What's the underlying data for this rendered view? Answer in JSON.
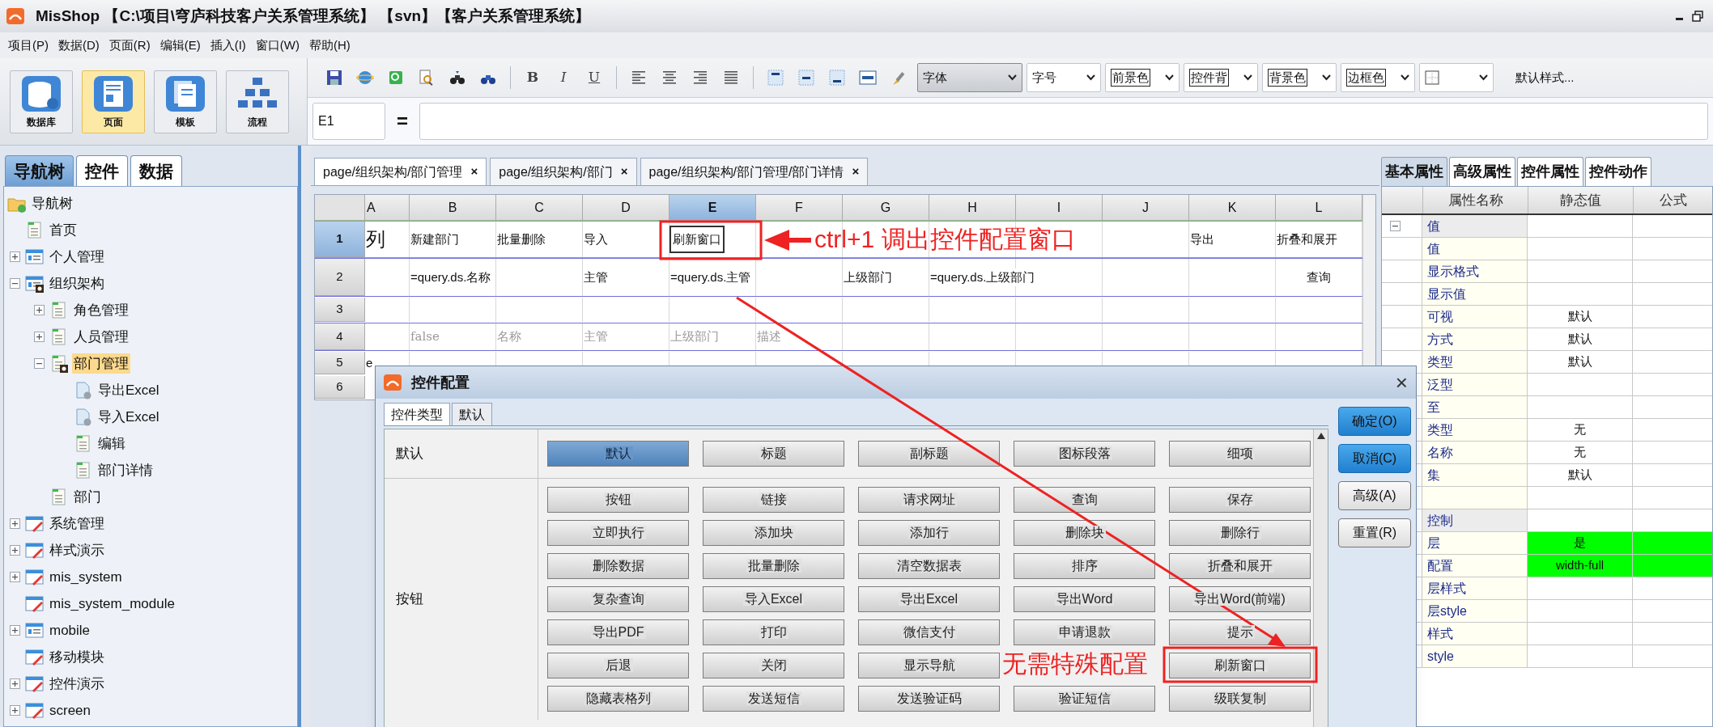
{
  "window": {
    "title": "MisShop 【C:\\项目\\穹庐科技客户关系管理系统】 【svn】【客户关系管理系统】"
  },
  "menu": [
    "项目(P)",
    "数据(D)",
    "页面(R)",
    "编辑(E)",
    "插入(I)",
    "窗口(W)",
    "帮助(H)"
  ],
  "modes": [
    {
      "label": "数据库",
      "kind": "database",
      "selected": false
    },
    {
      "label": "页面",
      "kind": "page",
      "selected": true
    },
    {
      "label": "模板",
      "kind": "template",
      "selected": false
    },
    {
      "label": "流程",
      "kind": "flow",
      "selected": false
    }
  ],
  "text_style_buttons": [
    "B",
    "I",
    "U"
  ],
  "format_selects": [
    {
      "label": "字体",
      "kind": "plain"
    },
    {
      "label": "字号",
      "kind": "plain"
    },
    {
      "label": "前景色",
      "kind": "boxed"
    },
    {
      "label": "控件背",
      "kind": "boxed"
    },
    {
      "label": "背景色",
      "kind": "boxed"
    },
    {
      "label": "边框色",
      "kind": "boxed"
    }
  ],
  "default_style": "默认样式...",
  "formula_bar": {
    "cell": "E1",
    "equals": "="
  },
  "nav_tabs": [
    {
      "label": "导航树",
      "selected": true
    },
    {
      "label": "控件",
      "selected": false
    },
    {
      "label": "数据",
      "selected": false
    }
  ],
  "tree": {
    "label": "导航树",
    "kind": "folder",
    "selected": false,
    "children": [
      {
        "label": "首页",
        "kind": "page",
        "selected": false
      },
      {
        "label": "个人管理",
        "kind": "list",
        "selected": false,
        "expanded": false
      },
      {
        "label": "组织架构",
        "kind": "list_badge",
        "selected": false,
        "expanded": true,
        "children": [
          {
            "label": "角色管理",
            "kind": "page",
            "selected": false,
            "expanded": false
          },
          {
            "label": "人员管理",
            "kind": "page",
            "selected": false,
            "expanded": false
          },
          {
            "label": "部门管理",
            "kind": "page_badge",
            "selected": true,
            "expanded": true,
            "children": [
              {
                "label": "导出Excel",
                "kind": "doc",
                "selected": false
              },
              {
                "label": "导入Excel",
                "kind": "doc",
                "selected": false
              },
              {
                "label": "编辑",
                "kind": "page",
                "selected": false
              },
              {
                "label": "部门详情",
                "kind": "page",
                "selected": false
              }
            ]
          },
          {
            "label": "部门",
            "kind": "page",
            "selected": false
          }
        ]
      },
      {
        "label": "系统管理",
        "kind": "module",
        "selected": false,
        "expanded": false
      },
      {
        "label": "样式演示",
        "kind": "module",
        "selected": false,
        "expanded": false
      },
      {
        "label": "mis_system",
        "kind": "module",
        "selected": false,
        "expanded": false
      },
      {
        "label": "mis_system_module",
        "kind": "module",
        "selected": false
      },
      {
        "label": "mobile",
        "kind": "list",
        "selected": false,
        "expanded": false
      },
      {
        "label": "移动模块",
        "kind": "module",
        "selected": false
      },
      {
        "label": "控件演示",
        "kind": "module",
        "selected": false,
        "expanded": false
      },
      {
        "label": "screen",
        "kind": "module",
        "selected": false,
        "expanded": false
      }
    ]
  },
  "doc_tabs": [
    {
      "label": "page/组织架构/部门管理",
      "close": "×",
      "selected": true
    },
    {
      "label": "page/组织架构/部门",
      "close": "×",
      "selected": false
    },
    {
      "label": "page/组织架构/部门管理/部门详情",
      "close": "×",
      "selected": false
    }
  ],
  "sheet": {
    "columns": [
      {
        "label": "A",
        "selected": false
      },
      {
        "label": "B",
        "selected": false
      },
      {
        "label": "C",
        "selected": false
      },
      {
        "label": "D",
        "selected": false
      },
      {
        "label": "E",
        "selected": true
      },
      {
        "label": "F",
        "selected": false
      },
      {
        "label": "G",
        "selected": false
      },
      {
        "label": "H",
        "selected": false
      },
      {
        "label": "I",
        "selected": false
      },
      {
        "label": "J",
        "selected": false
      },
      {
        "label": "K",
        "selected": false
      },
      {
        "label": "L",
        "selected": false
      }
    ],
    "rows": [
      {
        "header": "1",
        "kind": "component",
        "selected": true,
        "cells": [
          "列",
          "新建部门",
          "批量删除",
          "导入",
          "刷新窗口",
          null,
          null,
          null,
          null,
          null,
          "导出",
          "折叠和展开"
        ]
      },
      {
        "header": "2",
        "kind": "binding",
        "selected": false,
        "cells": [
          null,
          "=query.ds.名称",
          null,
          "主管",
          "=query.ds.主管",
          null,
          "上级部门",
          "=query.ds.上级部门",
          null,
          null,
          null,
          "查询"
        ]
      },
      {
        "header": "3",
        "kind": "plain",
        "selected": false,
        "cells": [
          null,
          null,
          null,
          null,
          null,
          null,
          null,
          null,
          null,
          null,
          null,
          null
        ]
      },
      {
        "header": "4",
        "kind": "hint",
        "selected": false,
        "cells": [
          null,
          "false",
          "名称",
          "主管",
          "上级部门",
          "描述",
          null,
          null,
          null,
          null,
          null,
          null
        ]
      },
      {
        "header": "5",
        "kind": "plain",
        "selected": false,
        "cells": [
          "e",
          null,
          null,
          null,
          null,
          null,
          null,
          null,
          null,
          null,
          null,
          null
        ]
      },
      {
        "header": "6",
        "kind": "plain",
        "selected": false,
        "cells": [
          null,
          null,
          null,
          null,
          null,
          null,
          null,
          null,
          null,
          null,
          null,
          null
        ]
      }
    ]
  },
  "properties": {
    "tabs": [
      {
        "label": "基本属性",
        "selected": true
      },
      {
        "label": "高级属性",
        "selected": false
      },
      {
        "label": "控件属性",
        "selected": false
      },
      {
        "label": "控件动作",
        "selected": false
      }
    ],
    "columns": [
      "属性名称",
      "静态值",
      "公式"
    ],
    "rows": [
      {
        "name": "值",
        "kind": "group",
        "expanded": true,
        "highlighted": false
      },
      {
        "name": "值",
        "kind": "item",
        "highlighted": false
      },
      {
        "name": "显示格式",
        "kind": "item",
        "highlighted": false
      },
      {
        "name": "显示值",
        "kind": "item",
        "highlighted": false
      },
      {
        "name": "可视",
        "kind": "item",
        "value": "默认",
        "highlighted": false
      },
      {
        "name": "方式",
        "kind": "item",
        "value": "默认",
        "highlighted": false
      },
      {
        "name": "类型",
        "kind": "item",
        "value": "默认",
        "highlighted": false
      },
      {
        "name": "泛型",
        "kind": "item",
        "highlighted": false
      },
      {
        "name": "至",
        "kind": "item",
        "highlighted": false
      },
      {
        "name": "类型",
        "kind": "item",
        "value": "无",
        "highlighted": false
      },
      {
        "name": "名称",
        "kind": "item",
        "value": "无",
        "highlighted": false
      },
      {
        "name": "集",
        "kind": "item",
        "value": "默认",
        "highlighted": false
      },
      {
        "kind": "item",
        "highlighted": false
      },
      {
        "name": "控制",
        "kind": "group",
        "highlighted": false
      },
      {
        "name": "层",
        "kind": "item",
        "value": "是",
        "highlighted": true
      },
      {
        "name": "配置",
        "kind": "item",
        "value": "width-full",
        "highlighted": true
      },
      {
        "name": "层样式",
        "kind": "item",
        "highlighted": false
      },
      {
        "name": "层style",
        "kind": "item",
        "highlighted": false
      },
      {
        "name": "样式",
        "kind": "item",
        "highlighted": false
      },
      {
        "name": "style",
        "kind": "item",
        "highlighted": false
      }
    ]
  },
  "dialog": {
    "title": "控件配置",
    "close": "×",
    "tabs": [
      {
        "label": "控件类型",
        "selected": true
      },
      {
        "label": "默认",
        "selected": false
      }
    ],
    "groups": [
      {
        "label": "默认",
        "buttons": [
          {
            "label": "默认",
            "selected": true
          },
          {
            "label": "标题",
            "selected": false
          },
          {
            "label": "副标题",
            "selected": false
          },
          {
            "label": "图标段落",
            "selected": false
          },
          {
            "label": "细项",
            "selected": false
          }
        ]
      },
      {
        "label": "按钮",
        "buttons": [
          {
            "kind": "button",
            "label": "按钮",
            "selected": false
          },
          {
            "kind": "button",
            "label": "链接",
            "selected": false
          },
          {
            "kind": "button",
            "label": "请求网址",
            "selected": false
          },
          {
            "kind": "button",
            "label": "查询",
            "selected": false
          },
          {
            "kind": "button",
            "label": "保存",
            "selected": false
          },
          {
            "kind": "button",
            "label": "立即执行",
            "selected": false
          },
          {
            "kind": "button",
            "label": "添加块",
            "selected": false
          },
          {
            "kind": "button",
            "label": "添加行",
            "selected": false
          },
          {
            "kind": "button",
            "label": "删除块",
            "selected": false
          },
          {
            "kind": "button",
            "label": "删除行",
            "selected": false
          },
          {
            "kind": "button",
            "label": "删除数据",
            "selected": false
          },
          {
            "kind": "button",
            "label": "批量删除",
            "selected": false
          },
          {
            "kind": "button",
            "label": "清空数据表",
            "selected": false
          },
          {
            "kind": "button",
            "label": "排序",
            "selected": false
          },
          {
            "kind": "button",
            "label": "折叠和展开",
            "selected": false
          },
          {
            "kind": "button",
            "label": "复杂查询",
            "selected": false
          },
          {
            "kind": "button",
            "label": "导入Excel",
            "selected": false
          },
          {
            "kind": "button",
            "label": "导出Excel",
            "selected": false
          },
          {
            "kind": "button",
            "label": "导出Word",
            "selected": false
          },
          {
            "kind": "button",
            "label": "导出Word(前端)",
            "selected": false
          },
          {
            "kind": "button",
            "label": "导出PDF",
            "selected": false
          },
          {
            "kind": "button",
            "label": "打印",
            "selected": false
          },
          {
            "kind": "button",
            "label": "微信支付",
            "selected": false
          },
          {
            "kind": "button",
            "label": "申请退款",
            "selected": false
          },
          {
            "kind": "button",
            "label": "提示",
            "selected": false
          },
          {
            "kind": "button",
            "label": "后退",
            "selected": false
          },
          {
            "kind": "button",
            "label": "关闭",
            "selected": false
          },
          {
            "kind": "button",
            "label": "显示导航",
            "selected": false
          },
          {
            "kind": "covered"
          },
          {
            "kind": "button",
            "label": "刷新窗口",
            "selected": false
          },
          {
            "kind": "button",
            "label": "隐藏表格列",
            "selected": false
          },
          {
            "kind": "button",
            "label": "发送短信",
            "selected": false
          },
          {
            "kind": "button",
            "label": "发送验证码",
            "selected": false
          },
          {
            "kind": "button",
            "label": "验证短信",
            "selected": false
          },
          {
            "kind": "button",
            "label": "级联复制",
            "selected": false
          }
        ]
      }
    ],
    "actions": [
      {
        "label": "确定(O)",
        "kind": "primary"
      },
      {
        "label": "取消(C)",
        "kind": "primary"
      },
      {
        "label": "高级(A)",
        "kind": "normal"
      },
      {
        "label": "重置(R)",
        "kind": "normal"
      }
    ]
  },
  "annotations": [
    {
      "kind": "callout",
      "text": "ctrl+1 调出控件配置窗口"
    },
    {
      "kind": "note",
      "text": "无需特殊配置"
    }
  ]
}
